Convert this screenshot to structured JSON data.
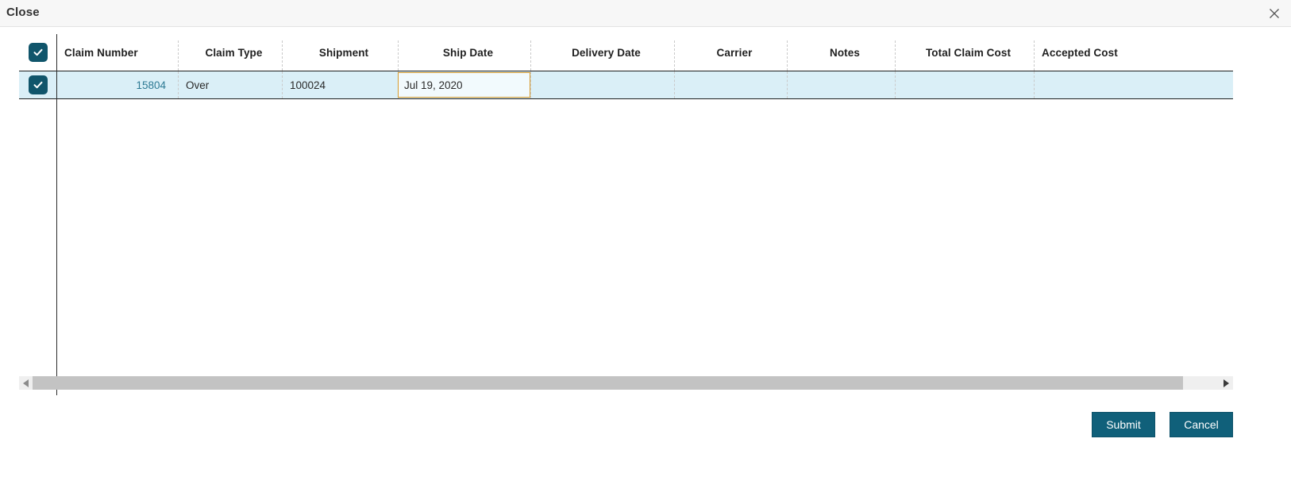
{
  "window": {
    "title": "Close",
    "close_icon": "close-icon"
  },
  "grid": {
    "select_all_checked": true,
    "columns": [
      {
        "key": "claim_number",
        "label": "Claim Number"
      },
      {
        "key": "claim_type",
        "label": "Claim Type"
      },
      {
        "key": "shipment",
        "label": "Shipment"
      },
      {
        "key": "ship_date",
        "label": "Ship Date"
      },
      {
        "key": "delivery_date",
        "label": "Delivery Date"
      },
      {
        "key": "carrier",
        "label": "Carrier"
      },
      {
        "key": "notes",
        "label": "Notes"
      },
      {
        "key": "total_claim_cost",
        "label": "Total Claim Cost"
      },
      {
        "key": "accepted_cost",
        "label": "Accepted Cost"
      }
    ],
    "rows": [
      {
        "selected": true,
        "claim_number": "15804",
        "claim_type": "Over",
        "shipment": "100024",
        "ship_date": "Jul 19, 2020",
        "delivery_date": "",
        "carrier": "",
        "notes": "",
        "total_claim_cost": "",
        "accepted_cost": ""
      }
    ],
    "editing_cell": {
      "column": "ship_date",
      "value": "Jul 19, 2020"
    },
    "scrollbar": {
      "left_arrow_icon": "arrow-left-icon",
      "right_arrow_icon": "arrow-right-icon"
    }
  },
  "footer": {
    "submit_label": "Submit",
    "cancel_label": "Cancel"
  },
  "colors": {
    "accent_teal": "#10607a",
    "checkbox_teal": "#10556b",
    "row_highlight": "#daeff7",
    "edit_border": "#d79a2b",
    "link_text": "#2d7a94",
    "titlebar_bg": "#f7f7f7"
  }
}
